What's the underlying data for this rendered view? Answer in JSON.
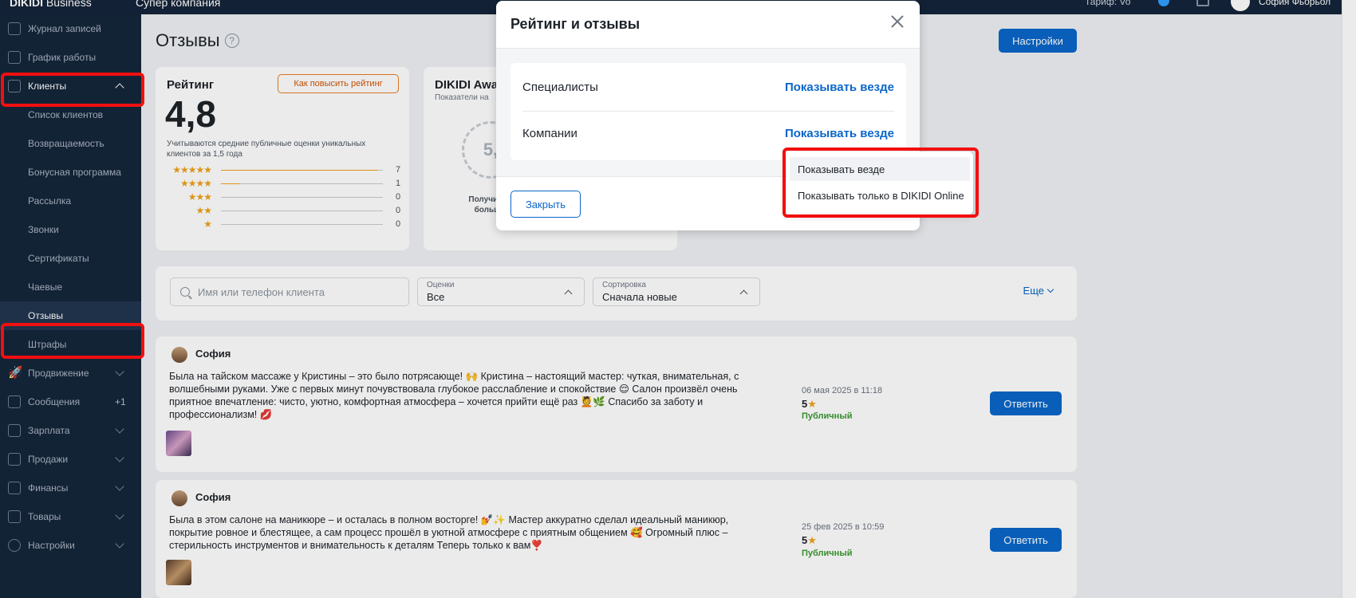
{
  "topbar": {
    "brand": "DIKIDI",
    "brand_suffix": " Business",
    "company": "Супер компания",
    "tariff": "Тариф: Vo",
    "user_name": "София Фьорьол"
  },
  "sidebar": {
    "items": [
      {
        "label": "Журнал записей"
      },
      {
        "label": "График работы"
      },
      {
        "label": "Клиенты"
      },
      {
        "label": "Список клиентов"
      },
      {
        "label": "Возвращаемость"
      },
      {
        "label": "Бонусная программа"
      },
      {
        "label": "Рассылка"
      },
      {
        "label": "Звонки"
      },
      {
        "label": "Сертификаты"
      },
      {
        "label": "Чаевые"
      },
      {
        "label": "Отзывы"
      },
      {
        "label": "Штрафы"
      },
      {
        "label": "Продвижение"
      },
      {
        "label": "Сообщения",
        "badge": "+1"
      },
      {
        "label": "Зарплата"
      },
      {
        "label": "Продажи"
      },
      {
        "label": "Финансы"
      },
      {
        "label": "Товары"
      },
      {
        "label": "Настройки"
      }
    ]
  },
  "page": {
    "title": "Отзывы",
    "help": "?",
    "settings_button": "Настройки"
  },
  "rating": {
    "title": "Рейтинг",
    "how_to_raise": "Как повысить рейтинг",
    "value": "4,8",
    "note": "Учитываются средние публичные оценки уникальных клиентов за 1,5 года",
    "rows": [
      {
        "stars": "★★★★★",
        "count": "7",
        "fraction": 0.97
      },
      {
        "stars": "★★★★",
        "count": "1",
        "fraction": 0.12
      },
      {
        "stars": "★★★",
        "count": "0",
        "fraction": 0
      },
      {
        "stars": "★★",
        "count": "0",
        "fraction": 0
      },
      {
        "stars": "★",
        "count": "0",
        "fraction": 0
      }
    ]
  },
  "award": {
    "title": "DIKIDI Awa",
    "subtitle": "Показатели на",
    "medal": "5,",
    "desc": "Получите больш"
  },
  "filters": {
    "search_placeholder": "Имя или телефон клиента",
    "ratings_caption": "Оценки",
    "ratings_value": "Все",
    "sort_caption": "Сортировка",
    "sort_value": "Сначала новые",
    "more": "Еще"
  },
  "reviews": [
    {
      "name": "София",
      "text": "Была на тайском массаже у Кристины – это было потрясающе! 🙌 Кристина – настоящий мастер: чуткая, внимательная, с волшебными руками. Уже с первых минут почувствовала глубокое расслабление и спокойствие 😌 Салон произвёл очень приятное впечатление: чисто, уютно, комфортная атмосфера – хочется прийти ещё раз 💆🌿 Спасибо за заботу и профессионализм! 💋",
      "date": "06 мая 2025 в 11:18",
      "score": "5",
      "visibility": "Публичный",
      "reply": "Ответить"
    },
    {
      "name": "София",
      "text": "Была в этом салоне на маникюре – и осталась в полном восторге! 💅✨ Мастер аккуратно сделал идеальный маникюр, покрытие ровное и блестящее, а сам процесс прошёл в уютной атмосфере с приятным общением 🥰 Огромный плюс – стерильность инструментов и внимательность к деталям Теперь только к вам❣️",
      "date": "25 фев 2025 в 10:59",
      "score": "5",
      "visibility": "Публичный",
      "reply": "Ответить"
    }
  ],
  "modal": {
    "title": "Рейтинг и отзывы",
    "rows": [
      {
        "name": "Специалисты",
        "value": "Показывать везде"
      },
      {
        "name": "Компании",
        "value": "Показывать везде"
      }
    ],
    "close_button": "Закрыть"
  },
  "dropdown": {
    "options": [
      "Показывать везде",
      "Показывать только в DIKIDI Online"
    ],
    "selected": "Показывать везде"
  },
  "colors": {
    "accent": "#0a66c9",
    "sidebar_bg": "#15263b",
    "highlight": "#f20f0f",
    "star": "#f0a11a",
    "public": "#3a9a31"
  }
}
